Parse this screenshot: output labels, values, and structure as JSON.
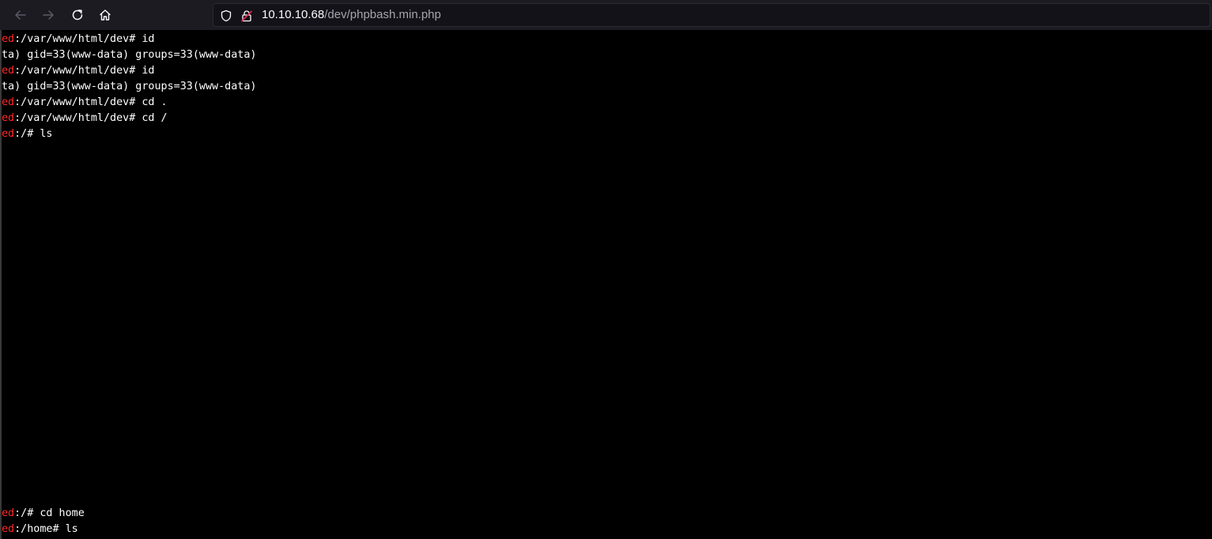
{
  "browser": {
    "url_host": "10.10.10.68",
    "url_path": "/dev/phpbash.min.php",
    "icons": {
      "back": "arrow-left-icon",
      "forward": "arrow-right-icon",
      "reload": "reload-icon",
      "home": "home-icon",
      "tracking": "shield-icon",
      "security": "insecure-lock-icon"
    }
  },
  "terminal": {
    "colors": {
      "background": "#000000",
      "user": "#ff2a2a",
      "text": "#ffffff"
    },
    "lines": [
      {
        "type": "prompt",
        "user": "ed",
        "path": ":/var/www/html/dev#",
        "command": " id"
      },
      {
        "type": "output",
        "text": "ta) gid=33(www-data) groups=33(www-data)"
      },
      {
        "type": "prompt",
        "user": "ed",
        "path": ":/var/www/html/dev#",
        "command": " id"
      },
      {
        "type": "output",
        "text": "ta) gid=33(www-data) groups=33(www-data)"
      },
      {
        "type": "prompt",
        "user": "ed",
        "path": ":/var/www/html/dev#",
        "command": " cd ."
      },
      {
        "type": "prompt",
        "user": "ed",
        "path": ":/var/www/html/dev#",
        "command": " cd /"
      },
      {
        "type": "prompt",
        "user": "ed",
        "path": ":/#",
        "command": " ls"
      },
      {
        "type": "prompt",
        "user": "ed",
        "path": ":/#",
        "command": " cd home"
      },
      {
        "type": "prompt",
        "user": "ed",
        "path": ":/home#",
        "command": " ls"
      }
    ]
  }
}
